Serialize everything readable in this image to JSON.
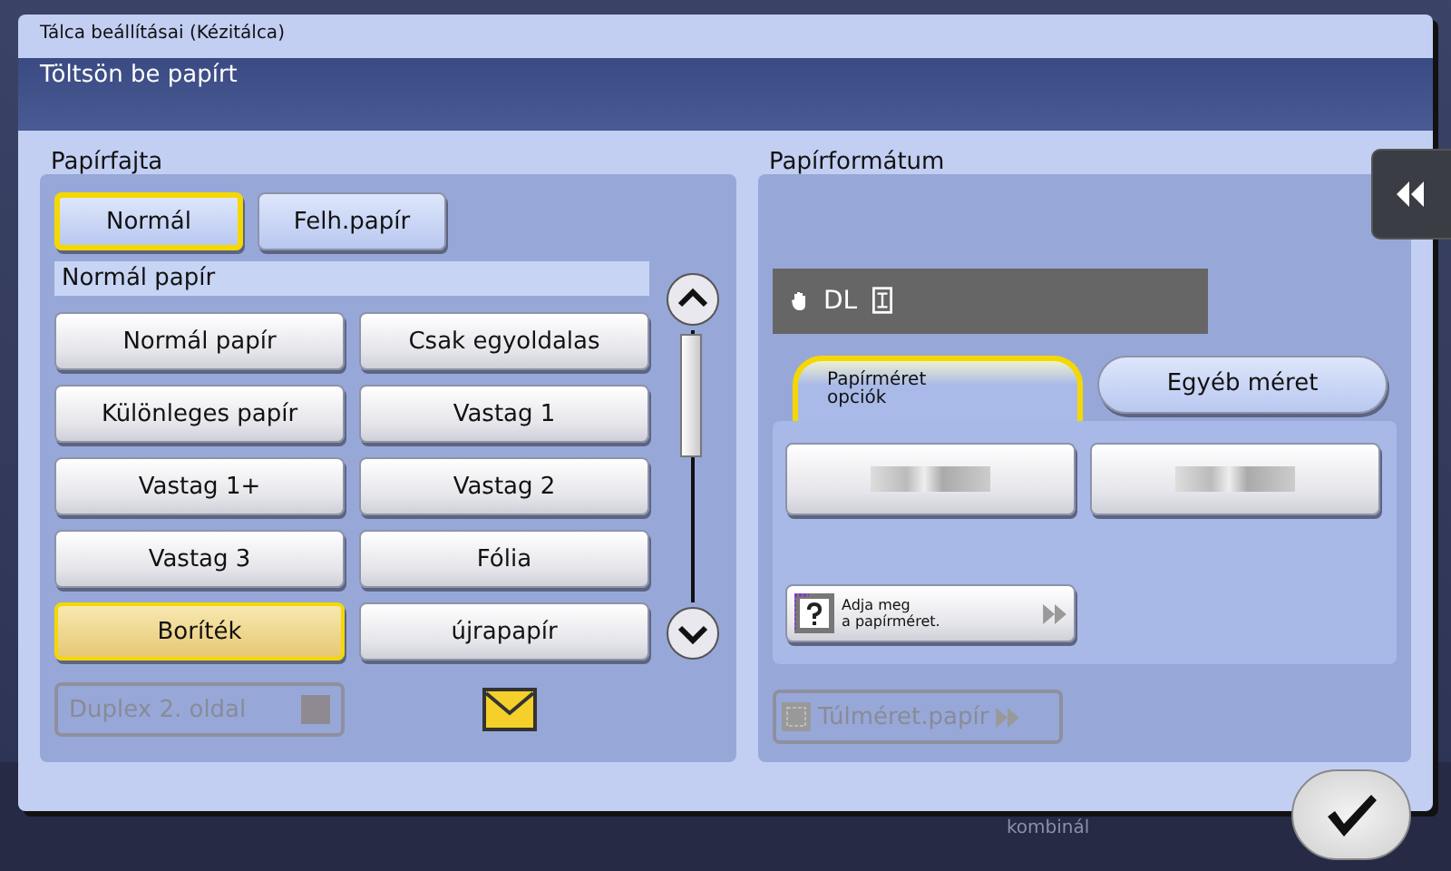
{
  "background_tabs": [
    {
      "label": "kombinál",
      "selected": false
    }
  ],
  "dialog": {
    "title": "Tálca beállításai (Kézitálca)",
    "message": "Töltsön be papírt"
  },
  "paper_type": {
    "label": "Papírfajta",
    "categories": [
      {
        "label": "Normál",
        "selected": true
      },
      {
        "label": "Felh.papír",
        "selected": false
      }
    ],
    "list_heading": "Normál papír",
    "options": [
      {
        "label": "Normál papír",
        "selected": false
      },
      {
        "label": "Csak egyoldalas",
        "selected": false
      },
      {
        "label": "Különleges papír",
        "selected": false
      },
      {
        "label": "Vastag 1",
        "selected": false
      },
      {
        "label": "Vastag 1+",
        "selected": false
      },
      {
        "label": "Vastag 2",
        "selected": false
      },
      {
        "label": "Vastag 3",
        "selected": false
      },
      {
        "label": "Fólia",
        "selected": false
      },
      {
        "label": "Boríték",
        "selected": true
      },
      {
        "label": "újrapapír",
        "selected": false
      }
    ],
    "duplex": {
      "label": "Duplex 2. oldal",
      "disabled": true
    }
  },
  "paper_format": {
    "label": "Papírformátum",
    "current": "DL",
    "tabs": [
      {
        "label": "Papírméret\nopciók",
        "selected": true
      },
      {
        "label": "Egyéb méret",
        "selected": false
      }
    ],
    "custom_size": "Adja meg\na papírméret.",
    "oversize": {
      "label": "Túlméret.papír",
      "disabled": true
    }
  }
}
